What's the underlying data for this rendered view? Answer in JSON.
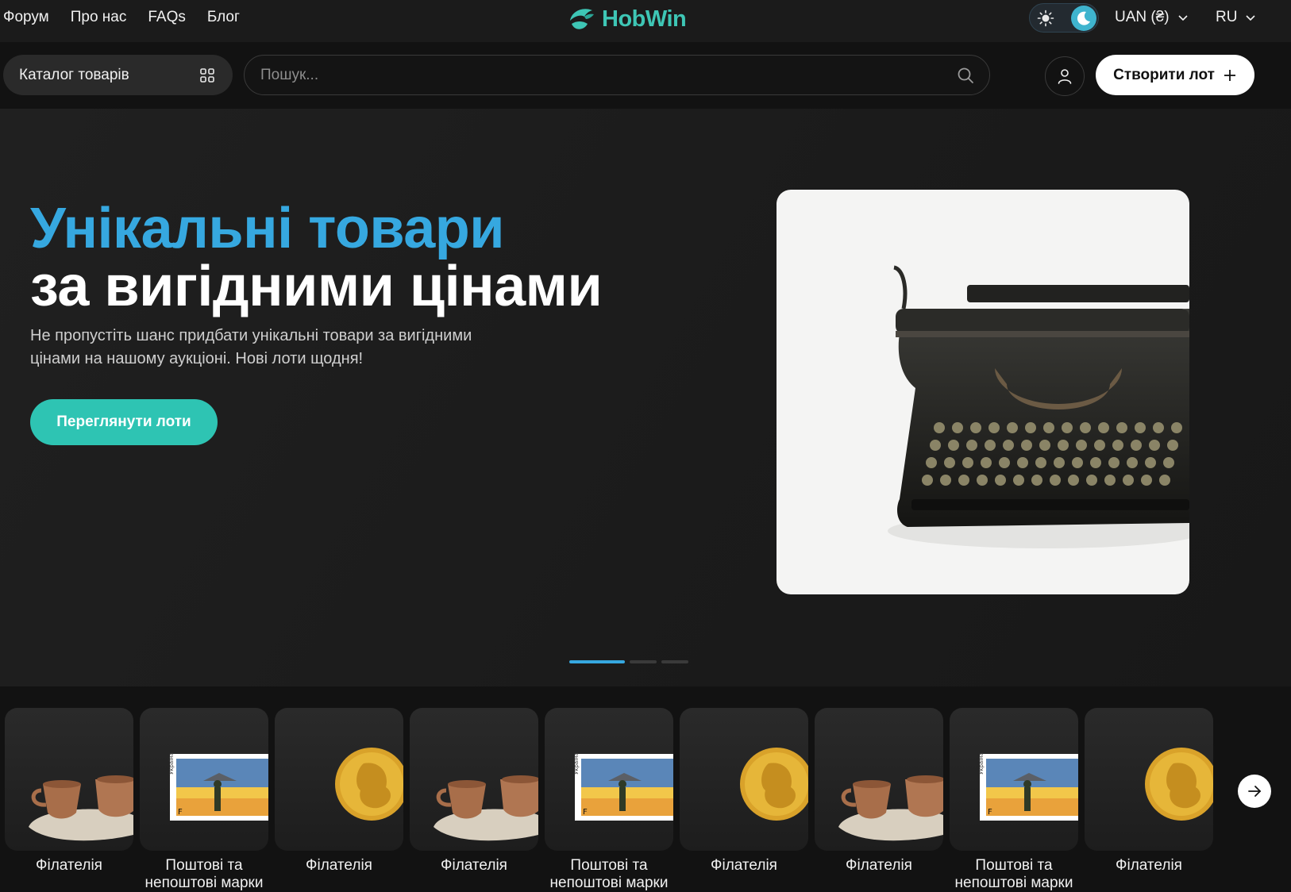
{
  "topbar": {
    "nav": [
      "Форум",
      "Про нас",
      "FAQs",
      "Блог"
    ],
    "logo_text": "HobWin",
    "currency": "UAN (₴)",
    "language": "RU",
    "theme_icons": [
      "sun-icon",
      "moon-icon"
    ]
  },
  "search_row": {
    "catalog_label": "Каталог товарів",
    "search_placeholder": "Пошук...",
    "create_label": "Створити лот"
  },
  "hero": {
    "title_accent": "Унікальні товари",
    "title_rest": "за вигідними цінами",
    "subtitle": "Не пропустіть шанс придбати унікальні товари за вигідними цінами на нашому аукціоні. Нові лоти щодня!",
    "cta": "Переглянути лоти",
    "slides": 3,
    "active_slide": 1
  },
  "categories": [
    {
      "label": "Філателія",
      "image": "clay-cups"
    },
    {
      "label": "Поштові та непоштові марки",
      "image": "stamp"
    },
    {
      "label": "Філателія",
      "image": "gold-coin"
    },
    {
      "label": "Філателія",
      "image": "clay-cups"
    },
    {
      "label": "Поштові та непоштові марки",
      "image": "stamp"
    },
    {
      "label": "Філателія",
      "image": "gold-coin"
    },
    {
      "label": "Філателія",
      "image": "clay-cups"
    },
    {
      "label": "Поштові та непоштові марки",
      "image": "stamp"
    },
    {
      "label": "Філателія",
      "image": "gold-coin"
    }
  ],
  "colors": {
    "accent_blue": "#36a8e0",
    "accent_teal": "#2ec4b3",
    "background": "#141414"
  }
}
